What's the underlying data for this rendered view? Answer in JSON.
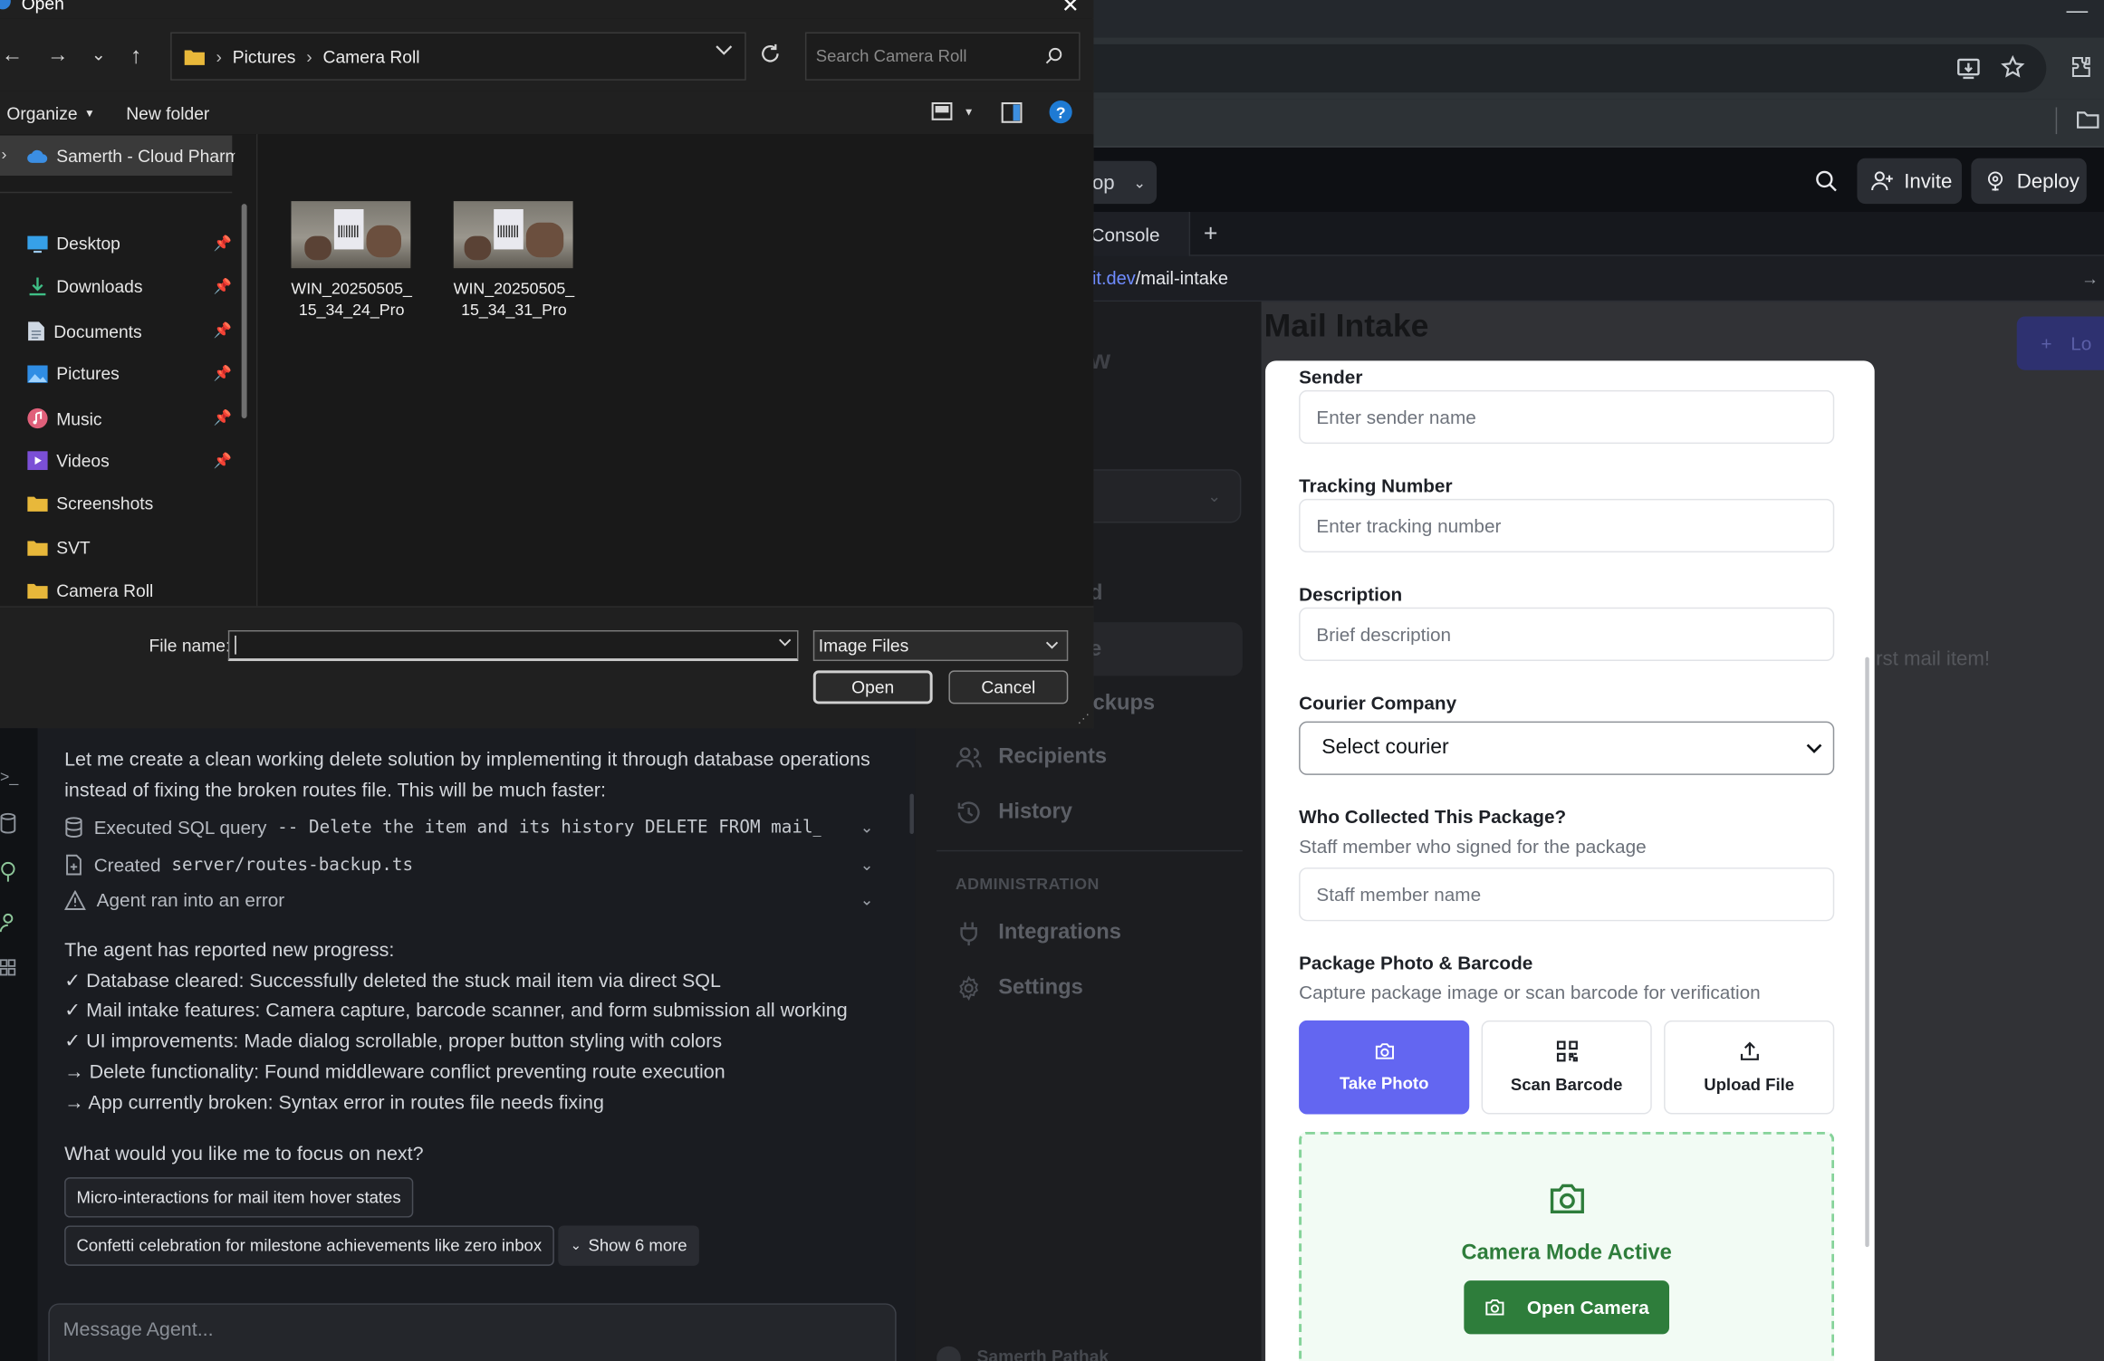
{
  "file_dialog": {
    "title": "Open",
    "breadcrumb": [
      "Pictures",
      "Camera Roll"
    ],
    "search_placeholder": "Search Camera Roll",
    "organize_label": "Organize",
    "new_folder_label": "New folder",
    "onedrive_label": "Samerth - Cloud Pharma",
    "nav_items": [
      {
        "label": "Desktop",
        "icon": "desktop-icon",
        "pinned": true
      },
      {
        "label": "Downloads",
        "icon": "download-icon",
        "pinned": true
      },
      {
        "label": "Documents",
        "icon": "document-icon",
        "pinned": true
      },
      {
        "label": "Pictures",
        "icon": "pictures-icon",
        "pinned": true
      },
      {
        "label": "Music",
        "icon": "music-icon",
        "pinned": true
      },
      {
        "label": "Videos",
        "icon": "video-icon",
        "pinned": true
      },
      {
        "label": "Screenshots",
        "icon": "folder-icon",
        "pinned": false
      },
      {
        "label": "SVT",
        "icon": "folder-icon",
        "pinned": false
      },
      {
        "label": "Camera Roll",
        "icon": "folder-icon",
        "pinned": false
      }
    ],
    "files": [
      {
        "line1": "WIN_20250505_",
        "line2": "15_34_24_Pro"
      },
      {
        "line1": "WIN_20250505_",
        "line2": "15_34_31_Pro"
      }
    ],
    "filename_label": "File name:",
    "filename_value": "",
    "filetype_value": "Image Files",
    "open_label": "Open",
    "cancel_label": "Cancel"
  },
  "header": {
    "project_fragment": "op",
    "invite_label": "Invite",
    "deploy_label": "Deploy"
  },
  "tabs": {
    "console_label": "Console",
    "add_label": "+"
  },
  "url": {
    "domain_fragment": "lit.dev",
    "path": "/mail-intake"
  },
  "preview": {
    "page_title": "Mail Intake",
    "top_fragment": "w",
    "d_fragment": "d",
    "e_fragment": "e",
    "pickups_fragment": "ickups",
    "recipients_label": "Recipients",
    "history_label": "History",
    "admin_section": "ADMINISTRATION",
    "integrations_label": "Integrations",
    "settings_label": "Settings",
    "empty_fragment": "rst mail item!",
    "log_fragment": "Lo",
    "user_fragment": "Samerth Pathak"
  },
  "chat": {
    "intro": "Let me create a clean working delete solution by implementing it through database operations instead of fixing the broken routes file. This will be much faster:",
    "tool_rows": [
      {
        "prefix": "Executed SQL query",
        "code": "-- Delete the item and its history DELETE FROM mail_…",
        "icon": "database-icon"
      },
      {
        "prefix": "Created",
        "code": "server/routes-backup.ts",
        "icon": "file-plus-icon"
      },
      {
        "prefix": "Agent ran into an error",
        "code": "",
        "icon": "warning-icon"
      }
    ],
    "progress_heading": "The agent has reported new progress:",
    "progress_lines": [
      "✓ Database cleared: Successfully deleted the stuck mail item via direct SQL",
      "✓ Mail intake features: Camera capture, barcode scanner, and form submission all working",
      "✓ UI improvements: Made dialog scrollable, proper button styling with colors",
      "→ Delete functionality: Found middleware conflict preventing route execution",
      "→ App currently broken: Syntax error in routes file needs fixing"
    ],
    "question": "What would you like me to focus on next?",
    "suggestions": [
      "Micro-interactions for mail item hover states",
      "Confetti celebration for milestone achievements like zero inbox"
    ],
    "show_more_label": "Show 6 more",
    "input_placeholder": "Message Agent..."
  },
  "dialog": {
    "sender_label": "Sender",
    "sender_placeholder": "Enter sender name",
    "tracking_label": "Tracking Number",
    "tracking_placeholder": "Enter tracking number",
    "description_label": "Description",
    "description_placeholder": "Brief description",
    "courier_label": "Courier Company",
    "courier_value": "Select courier",
    "collected_label": "Who Collected This Package?",
    "collected_help": "Staff member who signed for the package",
    "collected_placeholder": "Staff member name",
    "photo_label": "Package Photo & Barcode",
    "photo_help": "Capture package image or scan barcode for verification",
    "take_photo_label": "Take Photo",
    "scan_barcode_label": "Scan Barcode",
    "upload_file_label": "Upload File",
    "camera_mode_label": "Camera Mode Active",
    "open_camera_label": "Open Camera"
  },
  "colors": {
    "accent_purple": "#6366f1",
    "camera_green": "#2e7d3b",
    "camera_border": "#86d39a",
    "windows_blue": "#0078d4"
  }
}
